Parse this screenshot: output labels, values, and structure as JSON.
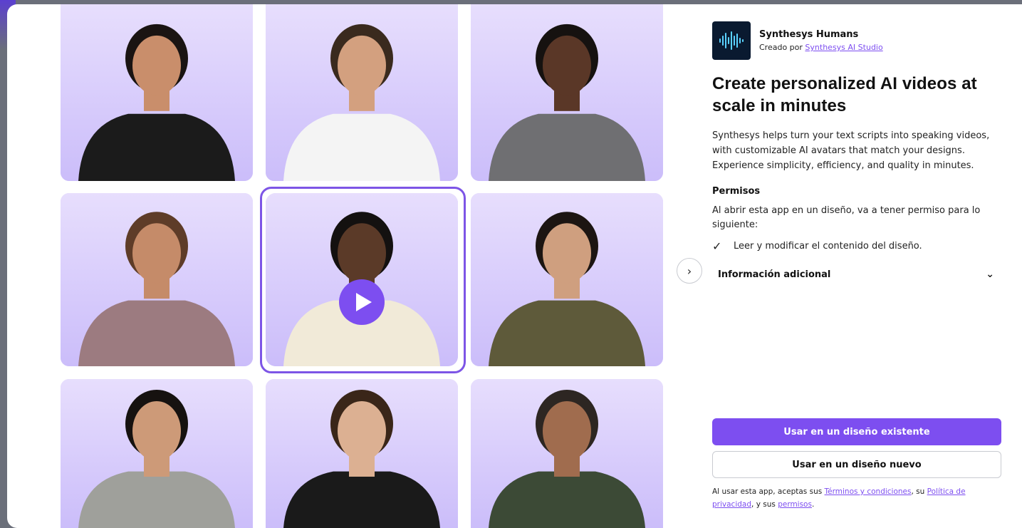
{
  "app": {
    "name": "Synthesys Humans",
    "created_by_prefix": "Creado por ",
    "created_by_link": "Synthesys AI Studio"
  },
  "headline": "Create personalized AI videos at scale in minutes",
  "description": "Synthesys helps turn your text scripts into speaking videos, with customizable AI avatars that match your designs. Experience simplicity, efficiency, and quality in minutes.",
  "permissions": {
    "title": "Permisos",
    "description": "Al abrir esta app en un diseño, va a tener permiso para lo siguiente:",
    "items": [
      "Leer y modificar el contenido del diseño."
    ]
  },
  "extra_info_label": "Información adicional",
  "buttons": {
    "use_existing": "Usar en un diseño existente",
    "use_new": "Usar en un diseño nuevo"
  },
  "legal": {
    "prefix": "Al usar esta app, aceptas sus ",
    "terms_link": "Términos y condiciones",
    "middle": ", su ",
    "privacy_link": "Política de privacidad",
    "and": ", y sus ",
    "permissions_link": "permisos",
    "suffix": "."
  },
  "icons": {
    "next": "chevron-right-icon",
    "expand": "chevron-down-icon",
    "check": "check-icon",
    "play": "play-icon",
    "logo": "waveform-logo-icon"
  },
  "colors": {
    "accent": "#7d4ef0",
    "tile_bg": "#d8ccfb"
  },
  "avatars": [
    {
      "id": "avatar-1",
      "skin": "#c98e6b",
      "hair": "#1a1412",
      "shirt": "#1b1b1b"
    },
    {
      "id": "avatar-2",
      "skin": "#d3a07f",
      "hair": "#3a2a1e",
      "shirt": "#f4f4f4"
    },
    {
      "id": "avatar-3",
      "skin": "#5a3727",
      "hair": "#161210",
      "shirt": "#6f6f72"
    },
    {
      "id": "avatar-4",
      "skin": "#c58b69",
      "hair": "#5e3c28",
      "shirt": "#9c7b80"
    },
    {
      "id": "avatar-5",
      "skin": "#5b3a28",
      "hair": "#141110",
      "shirt": "#f1ead8"
    },
    {
      "id": "avatar-6",
      "skin": "#cf9f7f",
      "hair": "#1c1512",
      "shirt": "#5e5a3a"
    },
    {
      "id": "avatar-7",
      "skin": "#cd9a78",
      "hair": "#161210",
      "shirt": "#9fa09b"
    },
    {
      "id": "avatar-8",
      "skin": "#dcb092",
      "hair": "#3a2619",
      "shirt": "#1a1a1a"
    },
    {
      "id": "avatar-9",
      "skin": "#a06c4e",
      "hair": "#2d2622",
      "shirt": "#3c4a36"
    }
  ]
}
